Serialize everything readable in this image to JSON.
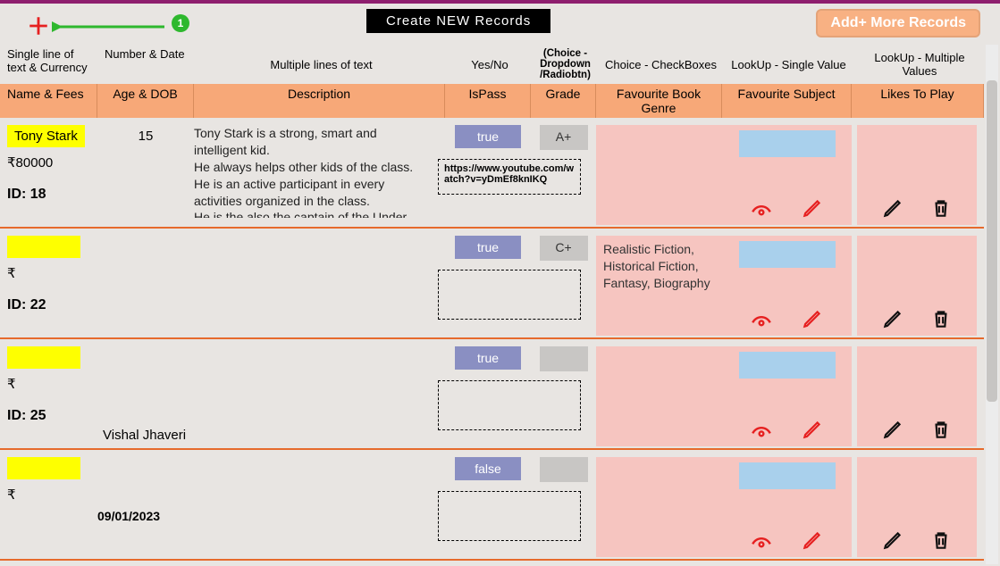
{
  "annotation": {
    "badge": "1"
  },
  "topbar": {
    "create_label": "Create  NEW  Records",
    "addmore_label": "Add+ More Records"
  },
  "headers_top": {
    "c1": "Single line of text & Currency",
    "c2": "Number & Date",
    "c3": "Multiple lines of text",
    "c4": "Yes/No",
    "c5": "(Choice - Dropdown /Radiobtn)",
    "c6": "Choice - CheckBoxes",
    "c7": "LookUp - Single Value",
    "c8": "LookUp - Multiple Values"
  },
  "headers_orange": {
    "c1": "Name & Fees",
    "c2": "Age & DOB",
    "c3": "Description",
    "c4": "IsPass",
    "c5": "Grade",
    "c6": "Favourite Book Genre",
    "c7": "Favourite Subject",
    "c8": "Likes To Play"
  },
  "rows": [
    {
      "id": "ID: 18",
      "name": "Tony Stark",
      "fees": "₹80000",
      "age": "15",
      "dob": "",
      "desc": "Tony Stark is a strong, smart and intelligent kid.\nHe always helps other kids of the class.\nHe is an active participant in every activities organized in the class.\nHe is the also the captain of the Under",
      "ispass": "true",
      "url": "https://www.youtube.com/watch?v=yDmEf8knIKQ",
      "grade": "A+",
      "genre": "",
      "extra_name": ""
    },
    {
      "id": "ID: 22",
      "name": "",
      "fees": "₹",
      "age": "",
      "dob": "",
      "desc": "",
      "ispass": "true",
      "url": "",
      "grade": "C+",
      "genre": "Realistic Fiction, Historical Fiction, Fantasy, Biography",
      "extra_name": ""
    },
    {
      "id": "ID: 25",
      "name": "",
      "fees": "₹",
      "age": "",
      "dob": "",
      "desc": "",
      "ispass": "true",
      "url": "",
      "grade": "",
      "genre": "",
      "extra_name": "Vishal Jhaveri"
    },
    {
      "id": "",
      "name": "",
      "fees": "₹",
      "age": "",
      "dob": "09/01/2023",
      "desc": "",
      "ispass": "false",
      "url": "",
      "grade": "",
      "genre": "",
      "extra_name": ""
    }
  ]
}
